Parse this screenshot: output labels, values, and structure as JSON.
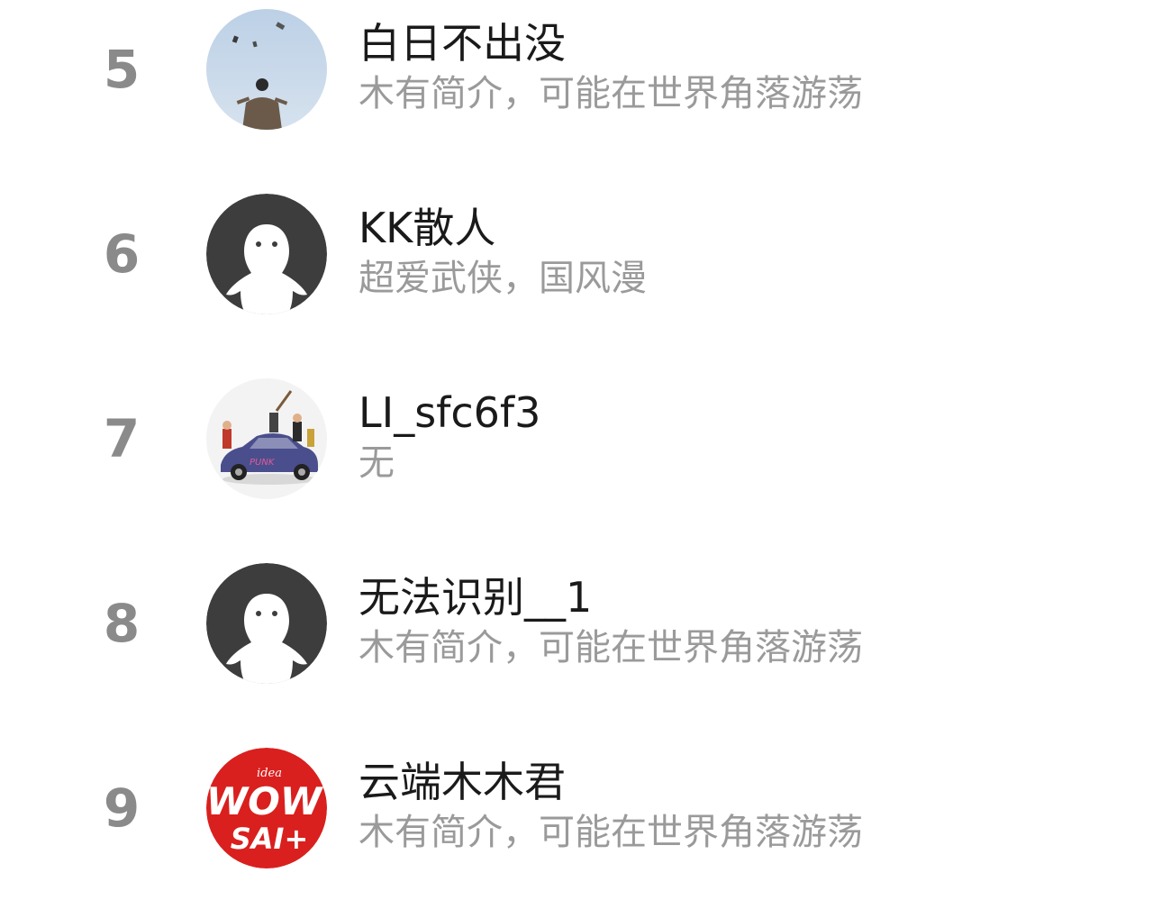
{
  "users": [
    {
      "rank": "5",
      "name": "白日不出没",
      "bio": "木有简介，可能在世界角落游荡",
      "avatar": "photo-person-sky"
    },
    {
      "rank": "6",
      "name": "KK散人",
      "bio": "超爱武侠，国风漫",
      "avatar": "default-ghost"
    },
    {
      "rank": "7",
      "name": "LI_sfc6f3",
      "bio": "无",
      "avatar": "illustration-car"
    },
    {
      "rank": "8",
      "name": "无法识别__1",
      "bio": "木有简介，可能在世界角落游荡",
      "avatar": "default-ghost"
    },
    {
      "rank": "9",
      "name": "云端木木君",
      "bio": "木有简介，可能在世界角落游荡",
      "avatar": "red-logo-wow-sai"
    }
  ],
  "logo": {
    "line1": "idea",
    "line2": "WOW",
    "line3": "SAI+"
  },
  "colors": {
    "rank": "#8a8a8a",
    "name": "#1a1a1a",
    "bio": "#9a9a9a",
    "default_avatar_bg": "#3d3d3d",
    "logo_red": "#d9201e"
  }
}
